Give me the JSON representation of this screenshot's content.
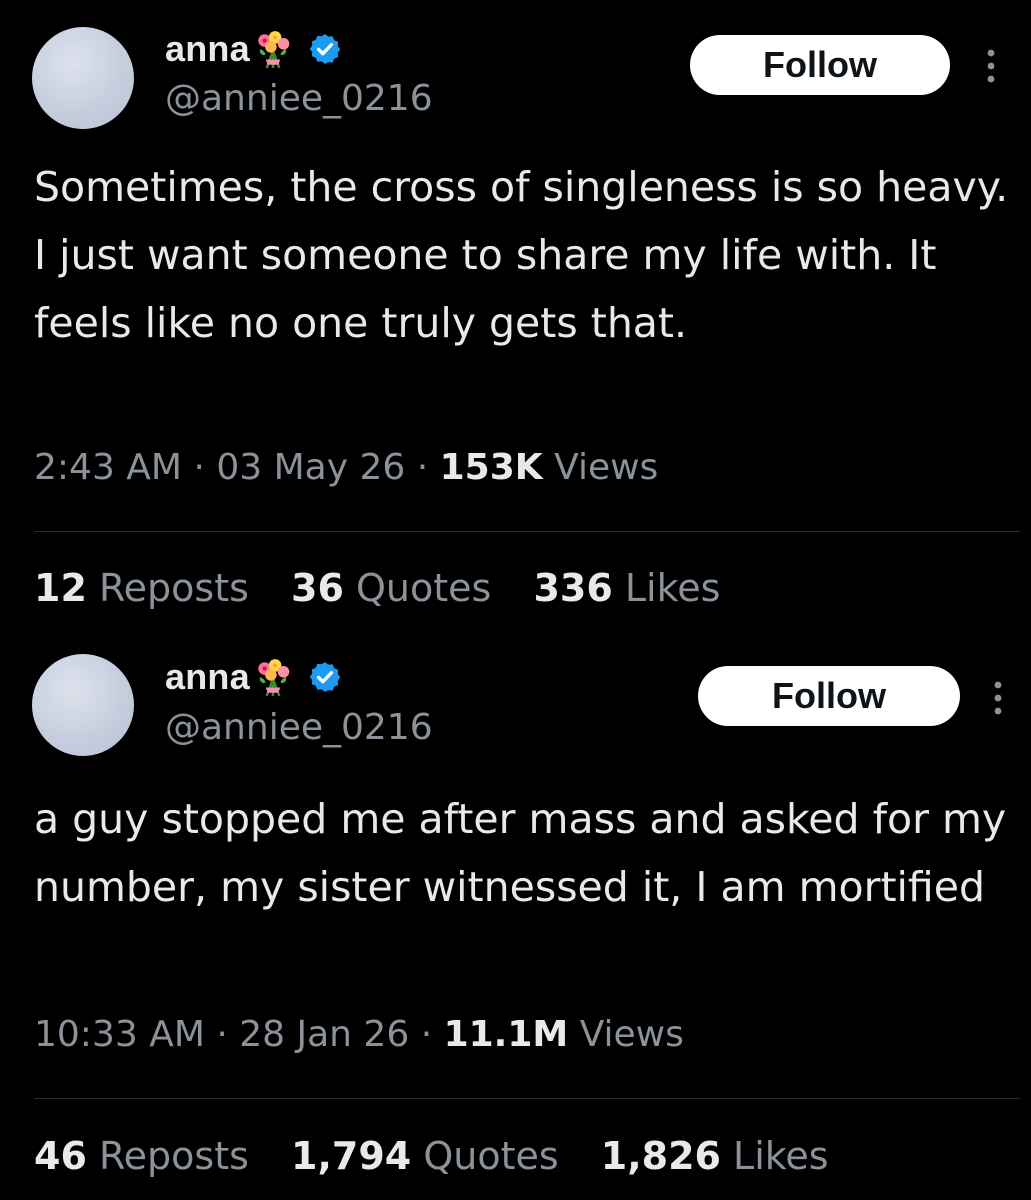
{
  "tweets": [
    {
      "display_name": "anna",
      "emoji_icon": "bouquet-icon",
      "verified_icon": "verified-badge-icon",
      "handle": "@anniee_0216",
      "follow_label": "Follow",
      "text": "Sometimes, the cross of singleness is so heavy. I just want someone to share my life with. It feels like no one truly gets that.",
      "time": "2:43 AM",
      "date": "03 May 26",
      "views_count": "153K",
      "views_label": "Views",
      "reposts_count": "12",
      "reposts_label": "Reposts",
      "quotes_count": "36",
      "quotes_label": "Quotes",
      "likes_count": "336",
      "likes_label": "Likes"
    },
    {
      "display_name": "anna",
      "emoji_icon": "bouquet-icon",
      "verified_icon": "verified-badge-icon",
      "handle": "@anniee_0216",
      "follow_label": "Follow",
      "text": "a guy stopped me after mass and asked for my number, my sister witnessed it, I am mortified",
      "time": "10:33 AM",
      "date": "28 Jan 26",
      "views_count": "11.1M",
      "views_label": "Views",
      "reposts_count": "46",
      "reposts_label": "Reposts",
      "quotes_count": "1,794",
      "quotes_label": "Quotes",
      "likes_count": "1,826",
      "likes_label": "Likes"
    }
  ],
  "colors": {
    "background": "#000000",
    "text_primary": "#e7e9ea",
    "text_secondary": "#8b9299",
    "verified_blue": "#1d9bf0",
    "follow_bg": "#ffffff"
  }
}
